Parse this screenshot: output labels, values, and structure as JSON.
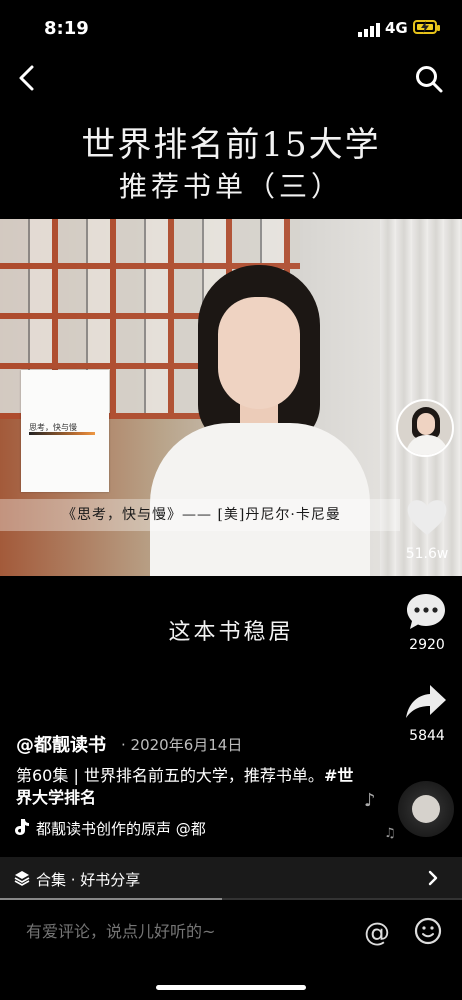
{
  "status_bar": {
    "time": "8:19",
    "network": "4G"
  },
  "headline": {
    "line1": "世界排名前15大学",
    "line2": "推荐书单（三）"
  },
  "video": {
    "book_cover_title": "思考，快与慢",
    "caption": "《思考，快与慢》—— [美]丹尼尔·卡尼曼",
    "subtitle": "这本书稳居"
  },
  "actions": {
    "likes": "51.6w",
    "comments": "2920",
    "shares": "5844"
  },
  "post": {
    "author": "@都靓读书",
    "date": "· 2020年6月14日",
    "description": "第60集 | 世界排名前五的大学，推荐书单。",
    "hashtag": "#世界大学排名",
    "music": "都靓读书创作的原声   @都"
  },
  "collection": {
    "label": "合集 · 好书分享"
  },
  "playback": {
    "progress_fraction": 0.48
  },
  "comment_input": {
    "placeholder": "有爱评论，说点儿好听的~",
    "at_symbol": "@"
  },
  "icons": [
    "back-icon",
    "search-icon",
    "heart-icon",
    "comment-icon",
    "share-icon",
    "music-note-icon",
    "collection-icon",
    "chevron-right-icon",
    "emoji-icon"
  ]
}
